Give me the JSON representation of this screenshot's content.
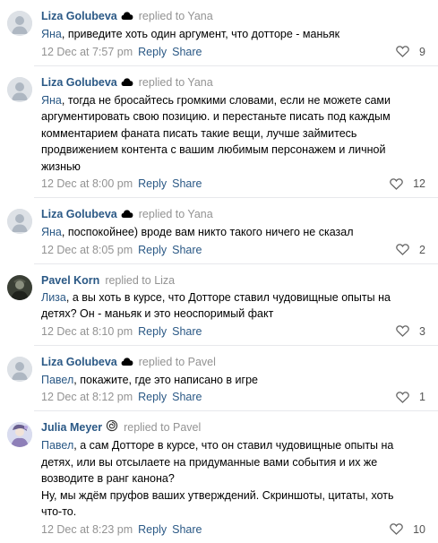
{
  "comments": [
    {
      "author": "Liza Golubeva",
      "status_icon": "cloud-icon",
      "replied_to": "replied to Yana",
      "mention": "Яна",
      "text": ", приведите хоть один аргумент, что дотторе - маньяк",
      "time": "12 Dec at 7:57 pm",
      "reply": "Reply",
      "share": "Share",
      "likes": "9"
    },
    {
      "author": "Liza Golubeva",
      "status_icon": "cloud-icon",
      "replied_to": "replied to Yana",
      "mention": "Яна",
      "text": ", тогда не бросайтесь громкими словами, если не можете сами аргументировать свою позицию. и перестаньте писать под каждым комментарием фаната писать такие вещи, лучше займитесь продвижением контента с вашим любимым персонажем и личной жизнью",
      "time": "12 Dec at 8:00 pm",
      "reply": "Reply",
      "share": "Share",
      "likes": "12"
    },
    {
      "author": "Liza Golubeva",
      "status_icon": "cloud-icon",
      "replied_to": "replied to Yana",
      "mention": "Яна",
      "text": ", поспокойнее) вроде вам никто такого ничего не сказал",
      "time": "12 Dec at 8:05 pm",
      "reply": "Reply",
      "share": "Share",
      "likes": "2"
    },
    {
      "author": "Pavel Korn",
      "status_icon": "",
      "replied_to": "replied to Liza",
      "mention": "Лиза",
      "text": ", а вы хоть в курсе, что Дотторе ставил чудовищные опыты на детях? Он - маньяк и это неоспоримый факт",
      "time": "12 Dec at 8:10 pm",
      "reply": "Reply",
      "share": "Share",
      "likes": "3"
    },
    {
      "author": "Liza Golubeva",
      "status_icon": "cloud-icon",
      "replied_to": "replied to Pavel",
      "mention": "Павел",
      "text": ", покажите, где это написано в игре",
      "time": "12 Dec at 8:12 pm",
      "reply": "Reply",
      "share": "Share",
      "likes": "1"
    },
    {
      "author": "Julia Meyer",
      "status_icon": "swirl-icon",
      "replied_to": "replied to Pavel",
      "mention": "Павел",
      "text": ", а сам Дотторе в курсе, что он ставил чудовищные опыты на детях, или вы отсылаете на придуманные вами события и их же возводите в ранг канона?\nНу, мы ждём пруфов ваших утверждений. Скриншоты, цитаты, хоть что-то.",
      "time": "12 Dec at 8:23 pm",
      "reply": "Reply",
      "share": "Share",
      "likes": "10"
    }
  ]
}
